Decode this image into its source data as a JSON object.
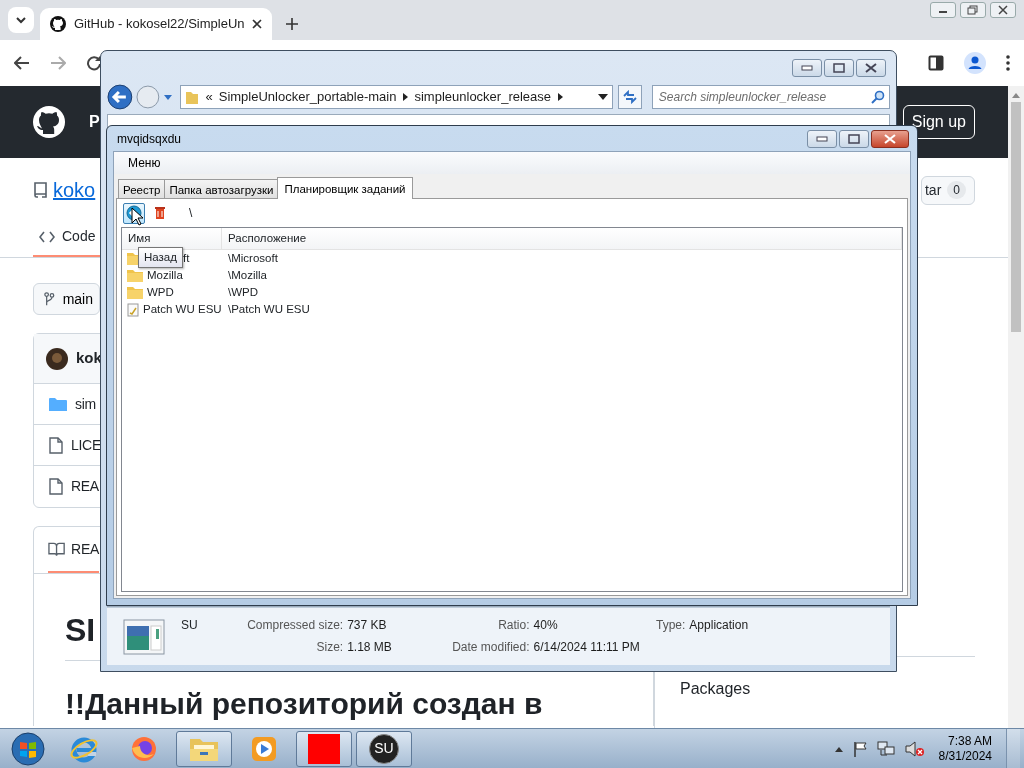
{
  "browser": {
    "tab": {
      "title": "GitHub - kokosel22/SimpleUn"
    }
  },
  "github": {
    "header_label": "P",
    "sign_up": "Sign up",
    "repo_name": "koko",
    "star": {
      "label": "tar",
      "count": "0"
    },
    "nav_tab": "Code",
    "branch": "main",
    "commit_author": "kok",
    "files": [
      {
        "kind": "folder",
        "name": "sim"
      },
      {
        "kind": "file",
        "name": "LICE"
      },
      {
        "kind": "file",
        "name": "REA"
      }
    ],
    "readme_tab": "REA",
    "heading": "SI",
    "subheading": "!!Данный репозиторий создан в",
    "sidebar_heading": "Packages"
  },
  "explorer": {
    "overflow_mark": "«",
    "breadcrumbs": [
      "SimpleUnlocker_portable-main",
      "simpleunlocker_release"
    ],
    "search_placeholder": "Search simpleunlocker_release",
    "details": {
      "name": "SU",
      "groups": [
        [
          {
            "label": "Compressed size:",
            "value": "737 KB"
          },
          {
            "label": "Size:",
            "value": "1.18 MB"
          }
        ],
        [
          {
            "label": "Ratio:",
            "value": "40%"
          },
          {
            "label": "Date modified:",
            "value": "6/14/2024 11:11 PM"
          }
        ],
        [
          {
            "label": "Type:",
            "value": "Application"
          }
        ]
      ]
    }
  },
  "app_window": {
    "title": "mvqidsqxdu",
    "menu": [
      "Меню"
    ],
    "tabs": [
      {
        "label": "Реестр",
        "selected": false
      },
      {
        "label": "Папка автозагрузки",
        "selected": false
      },
      {
        "label": "Планировщик заданий",
        "selected": true
      }
    ],
    "path": "\\",
    "tooltip": "Назад",
    "columns": [
      "Имя",
      "Расположение"
    ],
    "rows": [
      {
        "kind": "folder",
        "name": "ft",
        "location": "\\Microsoft"
      },
      {
        "kind": "folder",
        "name": "Mozilla",
        "location": "\\Mozilla"
      },
      {
        "kind": "folder",
        "name": "WPD",
        "location": "\\WPD"
      },
      {
        "kind": "task",
        "name": "Patch WU ESU",
        "location": "\\Patch WU ESU"
      }
    ]
  },
  "taskbar": {
    "apps": [
      {
        "kind": "ie",
        "running": false
      },
      {
        "kind": "firefox",
        "running": false
      },
      {
        "kind": "explorer",
        "running": true
      },
      {
        "kind": "media",
        "running": false
      },
      {
        "kind": "red",
        "running": true
      },
      {
        "kind": "su",
        "running": true,
        "logo_text": "SU"
      }
    ],
    "time": "7:38 AM",
    "date": "8/31/2024"
  }
}
